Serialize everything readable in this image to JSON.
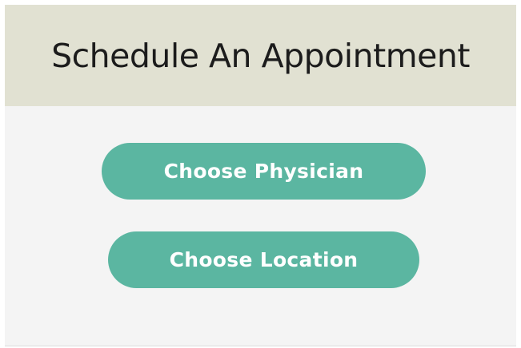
{
  "header": {
    "title": "Schedule An Appointment"
  },
  "actions": {
    "choose_physician_label": "Choose Physician",
    "choose_location_label": "Choose Location"
  },
  "colors": {
    "header_background": "#e1e1d2",
    "body_background": "#f4f4f4",
    "button_background": "#5bb6a1",
    "button_text": "#ffffff",
    "title_text": "#1c1c1c"
  }
}
